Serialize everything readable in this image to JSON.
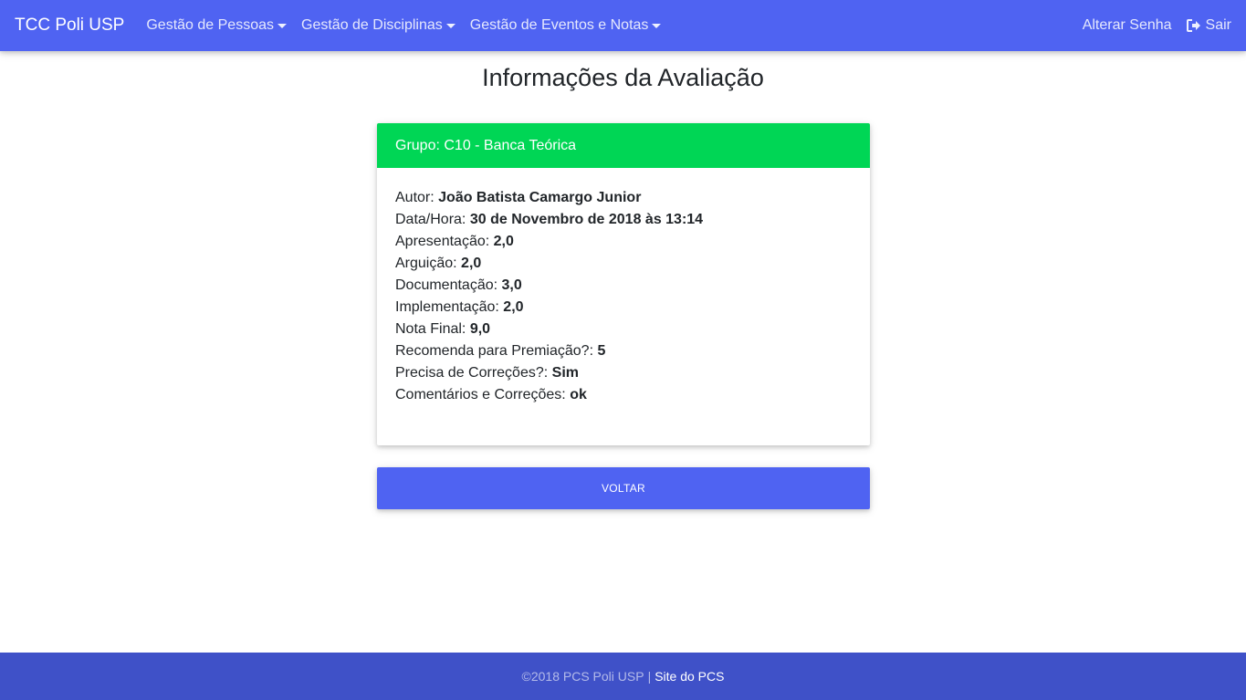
{
  "navbar": {
    "brand": "TCC Poli USP",
    "menus": [
      {
        "label": "Gestão de Pessoas"
      },
      {
        "label": "Gestão de Disciplinas"
      },
      {
        "label": "Gestão de Eventos e Notas"
      }
    ],
    "change_password": "Alterar Senha",
    "signout": "Sair"
  },
  "page": {
    "title": "Informações da Avaliação"
  },
  "card": {
    "header": "Grupo: C10 - Banca Teórica",
    "fields": [
      {
        "label": "Autor:",
        "value": "João Batista Camargo Junior"
      },
      {
        "label": "Data/Hora:",
        "value": "30 de Novembro de 2018 às 13:14"
      },
      {
        "label": "Apresentação:",
        "value": "2,0"
      },
      {
        "label": "Arguição:",
        "value": "2,0"
      },
      {
        "label": "Documentação:",
        "value": "3,0"
      },
      {
        "label": "Implementação:",
        "value": "2,0"
      },
      {
        "label": "Nota Final:",
        "value": "9,0"
      },
      {
        "label": "Recomenda para Premiação?:",
        "value": "5"
      },
      {
        "label": "Precisa de Correções?:",
        "value": "Sim"
      },
      {
        "label": "Comentários e Correções:",
        "value": "ok"
      }
    ]
  },
  "actions": {
    "back": "VOLTAR"
  },
  "footer": {
    "copyright": "©2018 PCS Poli USP",
    "separator": "|",
    "link": "Site do PCS"
  },
  "colors": {
    "primary": "#4f63f2",
    "card_header": "#00d655",
    "footer": "#3f51c8"
  },
  "icons": {
    "signout": "sign-out-icon",
    "dropdown": "caret-down-icon"
  }
}
